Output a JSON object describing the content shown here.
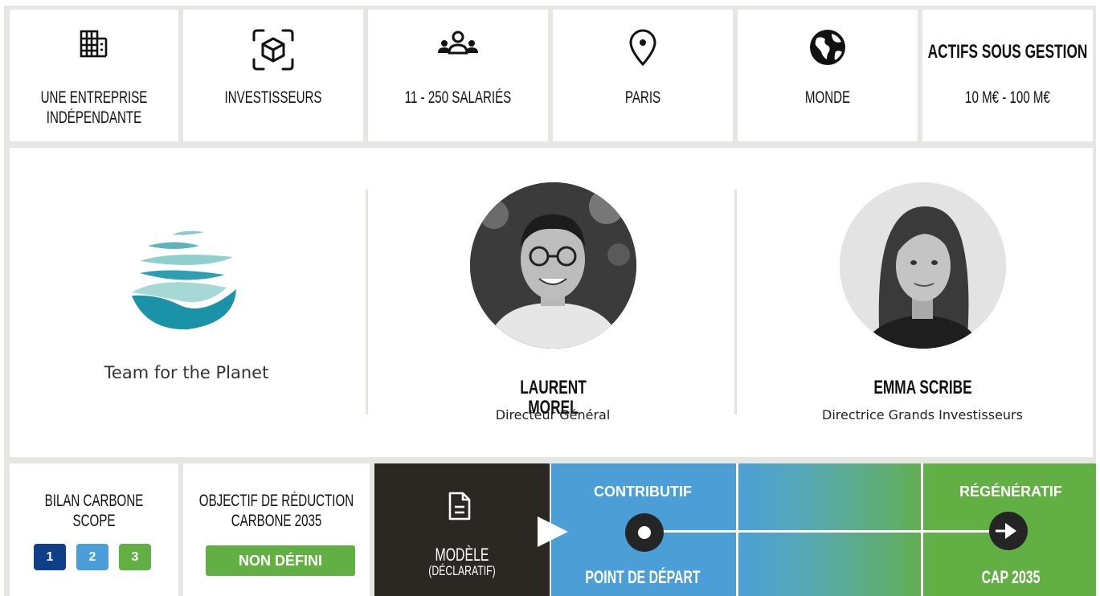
{
  "top_row": [
    {
      "icon": "building-icon",
      "label_line1": "UNE ENTREPRISE",
      "label_line2": "INDÉPENDANTE"
    },
    {
      "icon": "cube-scan-icon",
      "label_line1": "INVESTISSEURS"
    },
    {
      "icon": "people-group-icon",
      "label_line1": "11 - 250 SALARIÉS"
    },
    {
      "icon": "location-pin-icon",
      "label_line1": "PARIS"
    },
    {
      "icon": "globe-icon",
      "label_line1": "MONDE"
    },
    {
      "title": "ACTIFS SOUS GESTION",
      "value": "10 M€ - 100 M€"
    }
  ],
  "company": {
    "logo_text": "Team for the Planet"
  },
  "people": [
    {
      "name": "LAURENT MOREL",
      "role": "Directeur Général"
    },
    {
      "name": "EMMA SCRIBE",
      "role": "Directrice Grands Investisseurs"
    }
  ],
  "carbon": {
    "bilan_line1": "BILAN CARBONE",
    "bilan_line2": "SCOPE",
    "scopes": [
      "1",
      "2",
      "3"
    ],
    "objective_line1": "OBJECTIF DE RÉDUCTION",
    "objective_line2": "CARBONE  2035",
    "objective_value": "NON DÉFINI"
  },
  "model": {
    "line1": "MODÈLE",
    "line2": "(DÉCLARATIF)",
    "icon": "document-icon"
  },
  "trajectory": {
    "start_label": "CONTRIBUTIF",
    "start_caption": "POINT DE DÉPART",
    "end_label": "RÉGÉNÉRATIF",
    "end_caption": "CAP 2035"
  },
  "colors": {
    "scope1": "#0f3f86",
    "scope2": "#4a9fd8",
    "scope3": "#62b044",
    "model_bg": "#2b2824",
    "contrib_bg": "#4b9fd6",
    "regen_bg": "#62b044",
    "teal": "#2a9db0"
  }
}
